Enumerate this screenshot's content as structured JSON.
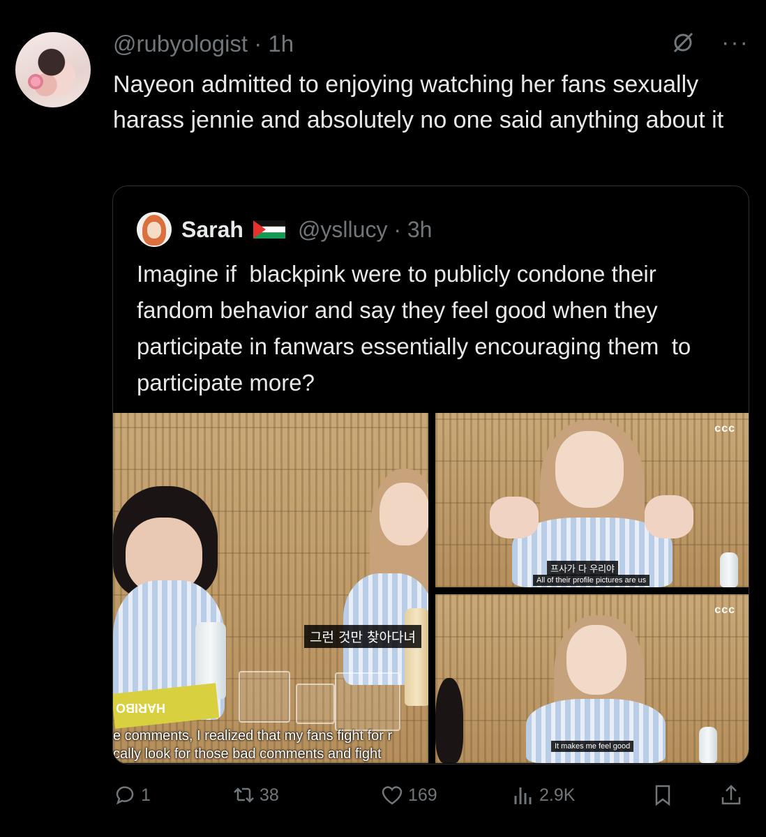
{
  "tweet": {
    "handle_time": "@rubyologist · 1h",
    "text": "Nayeon admitted to enjoying watching her fans sexually harass jennie and absolutely no one said anything about it"
  },
  "quote": {
    "name": "Sarah",
    "handle_time": "@ysllucy · 3h",
    "text": "Imagine if  blackpink were to publicly condone their  fandom behavior and say they feel good when they  participate in fanwars essentially encouraging them  to participate more?",
    "media": {
      "img1_caption_ko": "그런 것만 찾아다녀",
      "img1_caption_en_line1": "e comments, I realized that my fans fight for r",
      "img1_caption_en_line2": "cally look for those bad comments and fight",
      "img1_package_text": "HARIBO",
      "img2_caption_ko": "프사가 다 우리야",
      "img2_caption_en": "All of their profile pictures are us",
      "img3_caption_en": "It makes me feel good",
      "channel_logo": "ccc"
    }
  },
  "actions": {
    "replies": "1",
    "reposts": "38",
    "likes": "169",
    "views": "2.9K"
  },
  "colors": {
    "background": "#000000",
    "text": "#e7e9ea",
    "muted": "#71767b",
    "border": "#2f3336"
  },
  "icons": [
    "grok-icon",
    "more-icon",
    "reply-icon",
    "repost-icon",
    "like-icon",
    "views-icon",
    "bookmark-icon",
    "share-icon"
  ]
}
